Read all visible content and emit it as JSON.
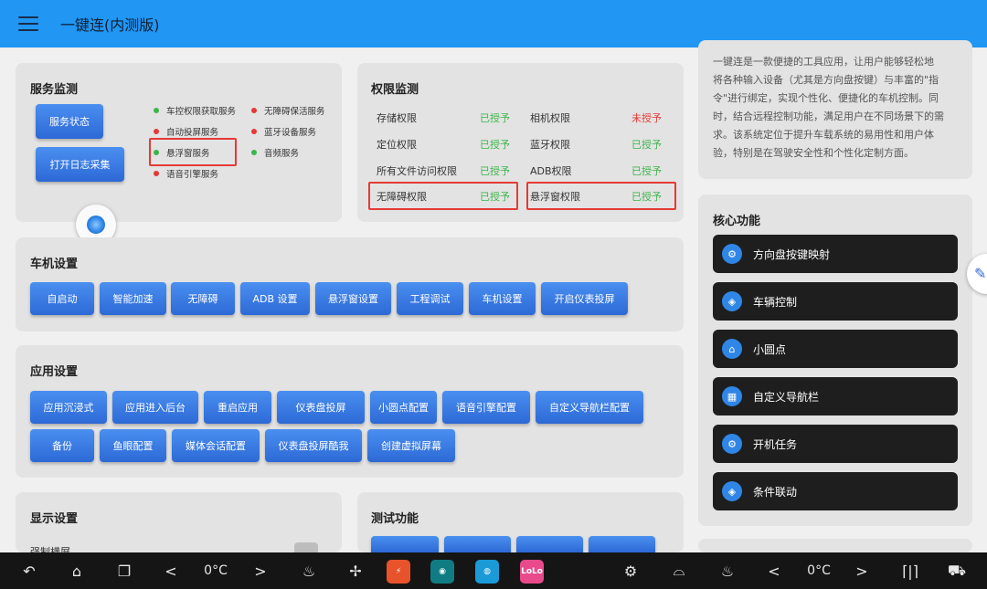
{
  "app_bar": {
    "title": "一键连(内测版)"
  },
  "service_monitor": {
    "title": "服务监测",
    "buttons": {
      "status": "服务状态",
      "log": "打开日志采集"
    },
    "services": [
      {
        "label": "车控权限获取服务",
        "status": "green"
      },
      {
        "label": "无障碍保活服务",
        "status": "red"
      },
      {
        "label": "自动投屏服务",
        "status": "red"
      },
      {
        "label": "蓝牙设备服务",
        "status": "red"
      },
      {
        "label": "悬浮窗服务",
        "status": "green"
      },
      {
        "label": "音频服务",
        "status": "green"
      },
      {
        "label": "语音引擎服务",
        "status": "red"
      }
    ]
  },
  "permission_monitor": {
    "title": "权限监测",
    "rows": [
      {
        "label": "存储权限",
        "status": "已授予",
        "granted": true
      },
      {
        "label": "相机权限",
        "status": "未授予",
        "granted": false
      },
      {
        "label": "定位权限",
        "status": "已授予",
        "granted": true
      },
      {
        "label": "蓝牙权限",
        "status": "已授予",
        "granted": true
      },
      {
        "label": "所有文件访问权限",
        "status": "已授予",
        "granted": true
      },
      {
        "label": "ADB权限",
        "status": "已授予",
        "granted": true
      },
      {
        "label": "无障碍权限",
        "status": "已授予",
        "granted": true
      },
      {
        "label": "悬浮窗权限",
        "status": "已授予",
        "granted": true
      }
    ]
  },
  "description": {
    "lines": [
      "一键连是一款便捷的工具应用，让用户能够轻松地",
      "将各种输入设备（尤其是方向盘按键）与丰富的\"指",
      "令\"进行绑定，实现个性化、便捷化的车机控制。同",
      "时，结合远程控制功能，满足用户在不同场景下的需",
      "求。该系统定位于提升车载系统的易用性和用户体",
      "验，特别是在驾驶安全性和个性化定制方面。"
    ]
  },
  "car_settings": {
    "title": "车机设置",
    "buttons": [
      "自启动",
      "智能加速",
      "无障碍",
      "ADB 设置",
      "悬浮窗设置",
      "工程调试",
      "车机设置",
      "开启仪表投屏"
    ]
  },
  "app_settings": {
    "title": "应用设置",
    "buttons": [
      "应用沉浸式",
      "应用进入后台",
      "重启应用",
      "仪表盘投屏",
      "小圆点配置",
      "语音引擎配置",
      "自定义导航栏配置",
      "备份",
      "鱼眼配置",
      "媒体会话配置",
      "仪表盘投屏酷我",
      "创建虚拟屏幕"
    ]
  },
  "core_functions": {
    "title": "核心功能",
    "items": [
      {
        "label": "方向盘按键映射",
        "icon": "gear-icon"
      },
      {
        "label": "车辆控制",
        "icon": "car-icon"
      },
      {
        "label": "小圆点",
        "icon": "home-icon"
      },
      {
        "label": "自定义导航栏",
        "icon": "grid-icon"
      },
      {
        "label": "开机任务",
        "icon": "gear-icon"
      },
      {
        "label": "条件联动",
        "icon": "car-icon"
      }
    ]
  },
  "display_settings": {
    "title": "显示设置",
    "partial_label": "强制横屏"
  },
  "test_functions": {
    "title": "测试功能"
  },
  "navbar": {
    "temp_left": "0°C",
    "temp_right": "0°C",
    "tiles": [
      {
        "label": "",
        "color": "#e8532b"
      },
      {
        "label": "",
        "color": "#0f7c84"
      },
      {
        "label": "",
        "color": "#1b9ad8"
      },
      {
        "label": "LoLo",
        "color": "#e84a8c"
      },
      {
        "label": "",
        "color": "#ffffff"
      }
    ]
  },
  "colors": {
    "appbar": "#2196f3",
    "button": "#2d69d6",
    "granted": "#3bb54a",
    "denied": "#e53935",
    "highlight": "#e53935"
  }
}
